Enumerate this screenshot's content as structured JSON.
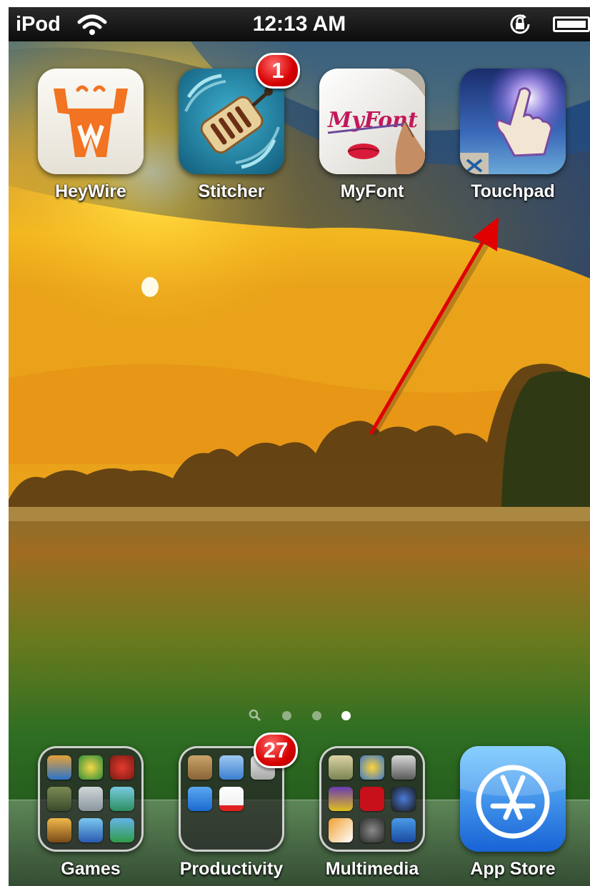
{
  "status_bar": {
    "carrier": "iPod",
    "time": "12:13 AM"
  },
  "home_apps": [
    {
      "label": "HeyWire",
      "icon": "heywire-icon"
    },
    {
      "label": "Stitcher",
      "icon": "stitcher-icon",
      "badge": "1"
    },
    {
      "label": "MyFont",
      "icon": "myfont-icon",
      "icon_text": "MyFont"
    },
    {
      "label": "Touchpad",
      "icon": "touchpad-icon"
    }
  ],
  "page_indicator": {
    "pages": 3,
    "current_page": 3,
    "has_spotlight": true
  },
  "dock": [
    {
      "label": "Games",
      "icon": "games-folder-icon"
    },
    {
      "label": "Productivity",
      "icon": "productivity-folder-icon",
      "badge": "27"
    },
    {
      "label": "Multimedia",
      "icon": "multimedia-folder-icon"
    },
    {
      "label": "App Store",
      "icon": "app-store-icon"
    }
  ],
  "annotation": {
    "type": "red-arrow",
    "points_to": "Touchpad",
    "color": "#e00000"
  },
  "colors": {
    "badge": "#d60000",
    "heywire_orange": "#f27321",
    "label": "#ffffff"
  }
}
